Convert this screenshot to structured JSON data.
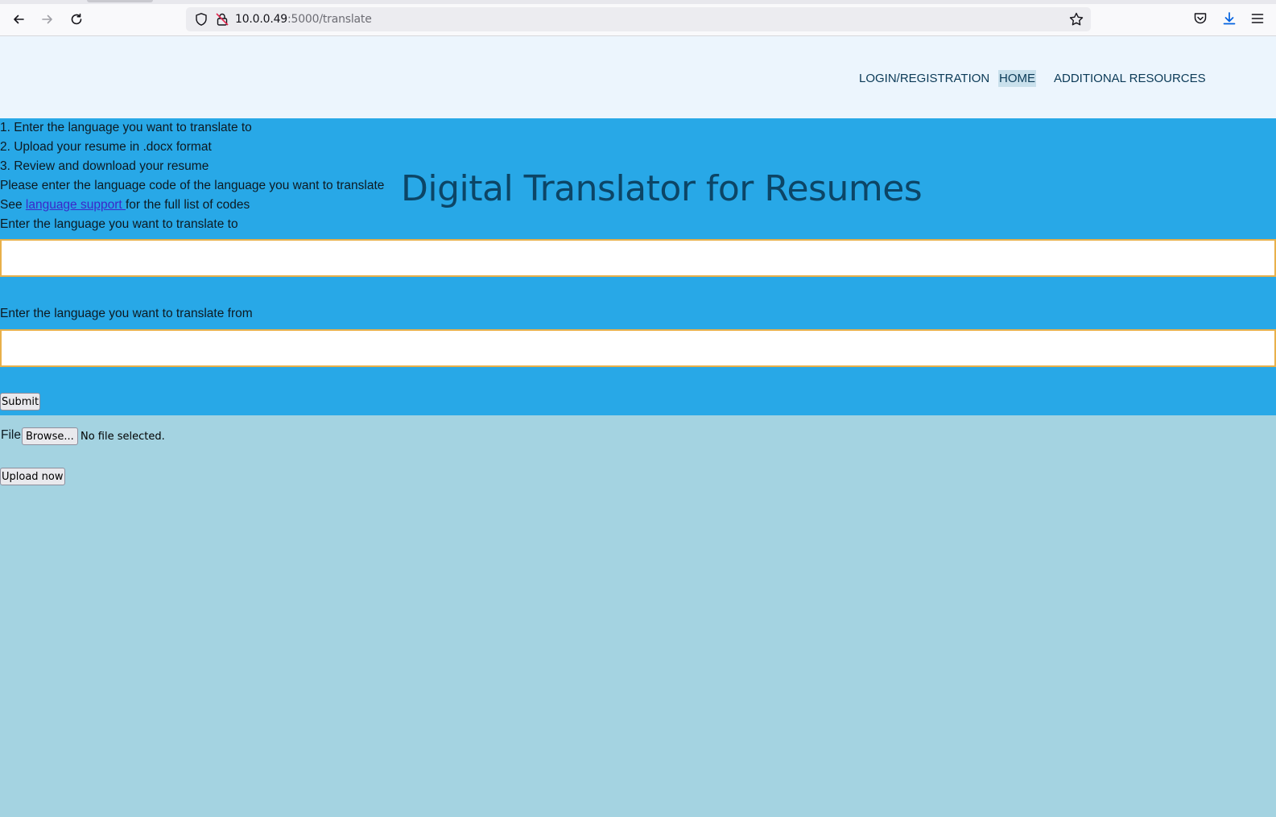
{
  "browser": {
    "url_host": "10.0.0.49",
    "url_path": ":5000/translate"
  },
  "nav": {
    "login": "LOGIN/REGISTRATION",
    "home": "HOME",
    "resources": "ADDITIONAL RESOURCES"
  },
  "instructions": {
    "step1": "1. Enter the language you want to translate to",
    "step2": "2. Upload your resume in .docx format",
    "step3": "3. Review and download your resume",
    "code_note": "Please enter the language code of the language you want to translate",
    "see_prefix": "See ",
    "support_link": "language support ",
    "see_suffix": "for the full list of codes"
  },
  "title": "Digital Translator for Resumes",
  "form": {
    "to_label": "Enter the language you want to translate to",
    "to_value": "",
    "from_label": "Enter the language you want to translate from",
    "from_value": "",
    "submit_label": "Submit"
  },
  "upload": {
    "file_label": "File",
    "browse_label": "Browse...",
    "file_status": "No file selected.",
    "upload_label": "Upload now"
  },
  "colors": {
    "header_bg": "#ecf5fd",
    "form_bg": "#28a8e7",
    "upload_bg": "#a4d3e1",
    "title_color": "#0c4566",
    "input_border": "#e8b04a"
  }
}
